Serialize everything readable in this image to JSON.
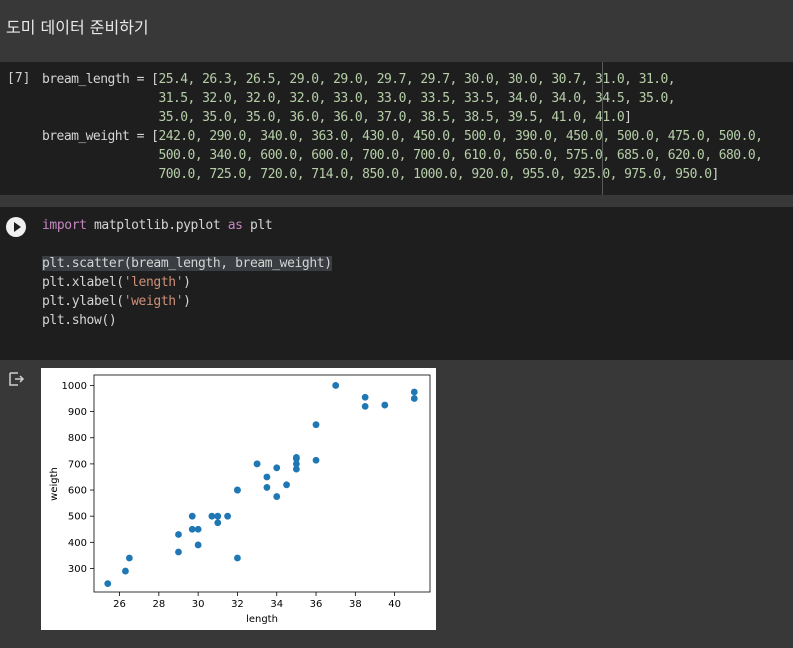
{
  "section_title": "도미 데이터 준비하기",
  "cell1": {
    "execution_count": "[7]",
    "bream_length_name": "bream_length",
    "bream_weight_name": "bream_weight",
    "bream_length_lines": [
      "25.4, 26.3, 26.5, 29.0, 29.0, 29.7, 29.7, 30.0, 30.0, 30.7, 31.0, 31.0,",
      "31.5, 32.0, 32.0, 32.0, 33.0, 33.0, 33.5, 33.5, 34.0, 34.0, 34.5, 35.0,",
      "35.0, 35.0, 35.0, 36.0, 36.0, 37.0, 38.5, 38.5, 39.5, 41.0, 41.0"
    ],
    "bream_weight_lines": [
      "242.0, 290.0, 340.0, 363.0, 430.0, 450.0, 500.0, 390.0, 450.0, 500.0, 475.0, 500.0,",
      "500.0, 340.0, 600.0, 600.0, 700.0, 700.0, 610.0, 650.0, 575.0, 685.0, 620.0, 680.0,",
      "700.0, 725.0, 720.0, 714.0, 850.0, 1000.0, 920.0, 955.0, 925.0, 975.0, 950.0"
    ]
  },
  "cell2": {
    "kw_import": "import",
    "module": "matplotlib.pyplot",
    "kw_as": "as",
    "alias": "plt",
    "scatter_call": "plt.scatter(bream_length, bream_weight)",
    "xlabel_prefix": "plt.xlabel(",
    "xlabel_arg": "'length'",
    "ylabel_prefix": "plt.ylabel(",
    "ylabel_arg": "'weigth'",
    "call_suffix": ")",
    "show_call": "plt.show()"
  },
  "icons": {
    "run": "play-circle-icon",
    "output": "output-arrow-icon"
  },
  "colors": {
    "marker": "#1f77b4",
    "background": "#383838",
    "cell": "#1e1e1e"
  },
  "chart_data": {
    "type": "scatter",
    "xlabel": "length",
    "ylabel": "weigth",
    "xlim": [
      24.7,
      41.8
    ],
    "ylim": [
      210,
      1040
    ],
    "xticks": [
      26,
      28,
      30,
      32,
      34,
      36,
      38,
      40
    ],
    "yticks": [
      300,
      400,
      500,
      600,
      700,
      800,
      900,
      1000
    ],
    "grid": false,
    "x": [
      25.4,
      26.3,
      26.5,
      29.0,
      29.0,
      29.7,
      29.7,
      30.0,
      30.0,
      30.7,
      31.0,
      31.0,
      31.5,
      32.0,
      32.0,
      32.0,
      33.0,
      33.0,
      33.5,
      33.5,
      34.0,
      34.0,
      34.5,
      35.0,
      35.0,
      35.0,
      35.0,
      36.0,
      36.0,
      37.0,
      38.5,
      38.5,
      39.5,
      41.0,
      41.0
    ],
    "y": [
      242.0,
      290.0,
      340.0,
      363.0,
      430.0,
      450.0,
      500.0,
      390.0,
      450.0,
      500.0,
      475.0,
      500.0,
      500.0,
      340.0,
      600.0,
      600.0,
      700.0,
      700.0,
      610.0,
      650.0,
      575.0,
      685.0,
      620.0,
      680.0,
      700.0,
      725.0,
      720.0,
      714.0,
      850.0,
      1000.0,
      920.0,
      955.0,
      925.0,
      975.0,
      950.0
    ]
  }
}
